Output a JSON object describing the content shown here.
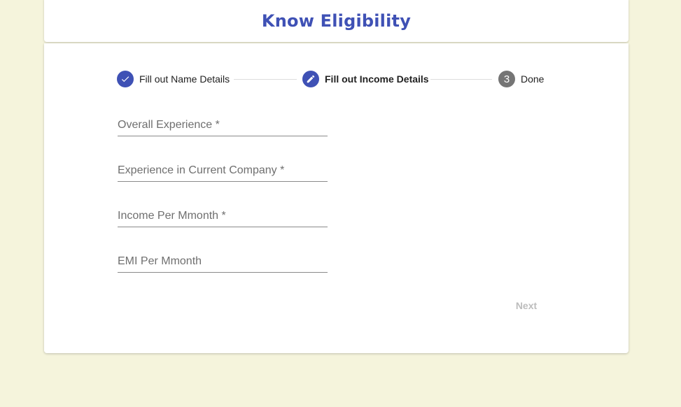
{
  "header": {
    "title": "Know Eligibility"
  },
  "stepper": {
    "steps": [
      {
        "label": "Fill out Name Details",
        "state": "completed",
        "icon": "check-icon"
      },
      {
        "label": "Fill out Income Details",
        "state": "editing",
        "icon": "pencil-icon"
      },
      {
        "label": "Done",
        "state": "pending",
        "number": "3"
      }
    ]
  },
  "form": {
    "fields": [
      {
        "label": "Overall Experience *",
        "value": ""
      },
      {
        "label": "Experience in Current Company *",
        "value": ""
      },
      {
        "label": "Income Per Mmonth *",
        "value": ""
      },
      {
        "label": "EMI Per Mmonth",
        "value": ""
      }
    ],
    "next_label": "Next"
  },
  "colors": {
    "accent": "#3f51b5",
    "background": "#f5f4dc",
    "pending_step": "#757575",
    "disabled_text": "#bdbdbd"
  }
}
